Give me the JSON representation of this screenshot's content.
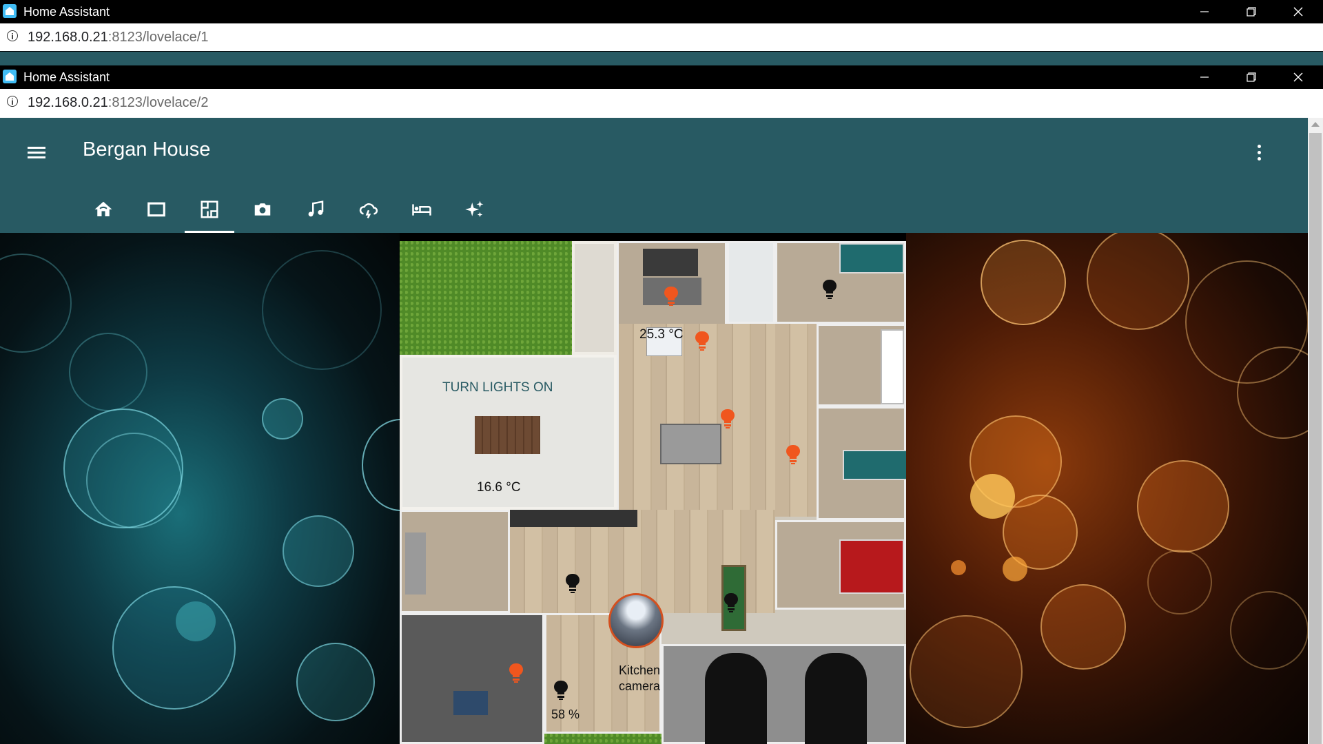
{
  "window1": {
    "title": "Home Assistant",
    "url_host": "192.168.0.21",
    "url_path": ":8123/lovelace/1"
  },
  "window2": {
    "title": "Home Assistant",
    "url_host": "192.168.0.21",
    "url_path": ":8123/lovelace/2"
  },
  "header": {
    "title": "Bergan House",
    "tabs": [
      {
        "icon": "home-icon"
      },
      {
        "icon": "rectangle-icon"
      },
      {
        "icon": "floorplan-icon",
        "active": true
      },
      {
        "icon": "camera-icon"
      },
      {
        "icon": "music-icon"
      },
      {
        "icon": "weather-icon"
      },
      {
        "icon": "bed-icon"
      },
      {
        "icon": "sparkles-icon"
      }
    ]
  },
  "floorplan": {
    "action_label": "TURN LIGHTS ON",
    "dining_temp": "16.6 °C",
    "bedroom_temp": "25.3 °C",
    "humidity": "58 %",
    "camera_label_line1": "Kitchen",
    "camera_label_line2": "camera",
    "colors": {
      "light_on": "#f0561e",
      "light_off": "#111111",
      "header_bg": "#285a63"
    }
  }
}
